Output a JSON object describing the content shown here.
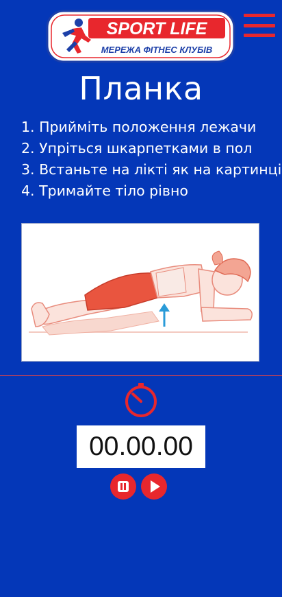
{
  "header": {
    "logo_text": "SPORT LIFE",
    "logo_subtitle": "МЕРЕЖА ФІТНЕС КЛУБІВ",
    "menu_icon": "hamburger-menu-icon"
  },
  "exercise": {
    "title": "Планка",
    "steps": [
      "1. Прийміть положення лежачи",
      "2. Упріться шкарпетками в пол",
      "3. Встаньте на лікті як на картинці",
      "4. Тримайте тіло рівно"
    ]
  },
  "timer": {
    "display": "00.00.00",
    "icon": "stopwatch-icon",
    "pause_icon": "pause-icon",
    "play_icon": "play-icon"
  },
  "colors": {
    "background": "#0437b8",
    "accent": "#e8272d",
    "text": "#ffffff"
  }
}
